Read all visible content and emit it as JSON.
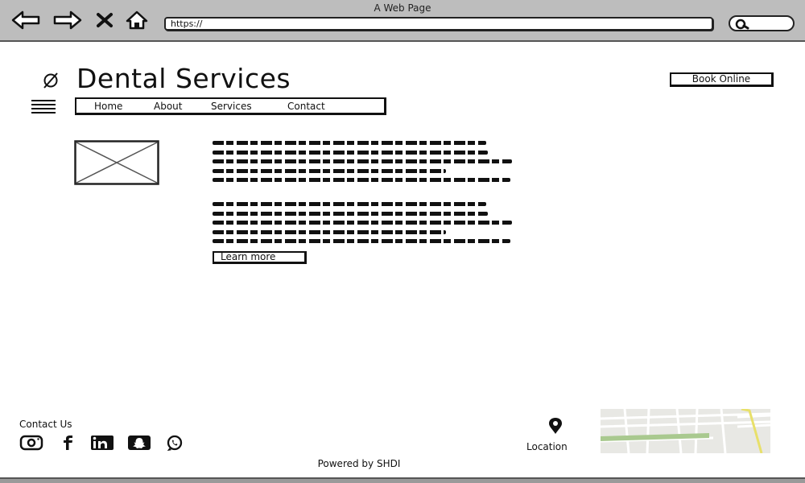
{
  "browser": {
    "window_title": "A Web Page",
    "url": "https://",
    "icons": [
      "back-arrow-icon",
      "forward-arrow-icon",
      "close-x-icon",
      "home-icon",
      "search-icon"
    ]
  },
  "header": {
    "logo_icon": "empty-set-icon",
    "title": "Dental Services",
    "book_button": "Book Online",
    "menu_icon": "hamburger-menu-icon",
    "nav": [
      {
        "label": "Home"
      },
      {
        "label": "About"
      },
      {
        "label": "Services"
      },
      {
        "label": "Contact"
      }
    ]
  },
  "main": {
    "image": "image-placeholder",
    "learn_more": "Learn more"
  },
  "footer": {
    "contact_label": "Contact Us",
    "social_icons": [
      "instagram-icon",
      "facebook-icon",
      "linkedin-icon",
      "snapchat-icon",
      "whatsapp-icon"
    ],
    "location_icon": "map-pin-icon",
    "location_label": "Location",
    "map": "map-thumbnail",
    "powered_by": "Powered by SHDI"
  },
  "colors": {
    "chrome_bg": "#bdbdbd",
    "ink": "#111111",
    "page_bg": "#ffffff",
    "map_green": "#a9c98f",
    "map_yellow": "#e8e06a"
  }
}
